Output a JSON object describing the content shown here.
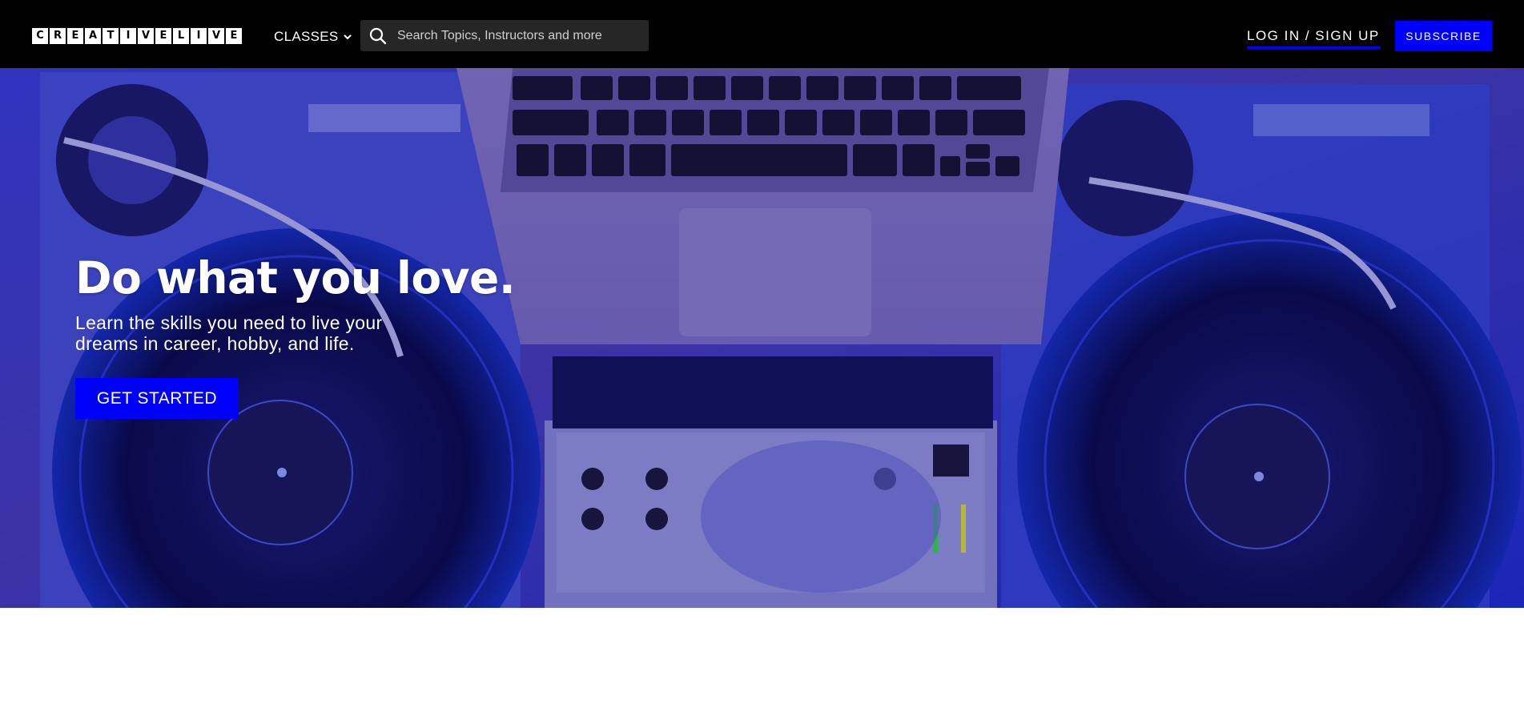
{
  "brand": {
    "logo_letters": [
      "C",
      "R",
      "E",
      "A",
      "T",
      "I",
      "V",
      "E",
      "L",
      "I",
      "V",
      "E"
    ],
    "accent_color": "#0000ff"
  },
  "nav": {
    "classes_label": "CLASSES",
    "search_placeholder": "Search Topics, Instructors and more",
    "login_label": "LOG IN / SIGN UP",
    "subscribe_label": "SUBSCRIBE"
  },
  "hero": {
    "title": "Do what you love.",
    "subtitle": "Learn the skills you need to live your dreams in career, hobby, and life.",
    "cta_label": "GET STARTED"
  },
  "icons": {
    "search": "search-icon",
    "classes_chevron": "chevron-down-icon"
  }
}
